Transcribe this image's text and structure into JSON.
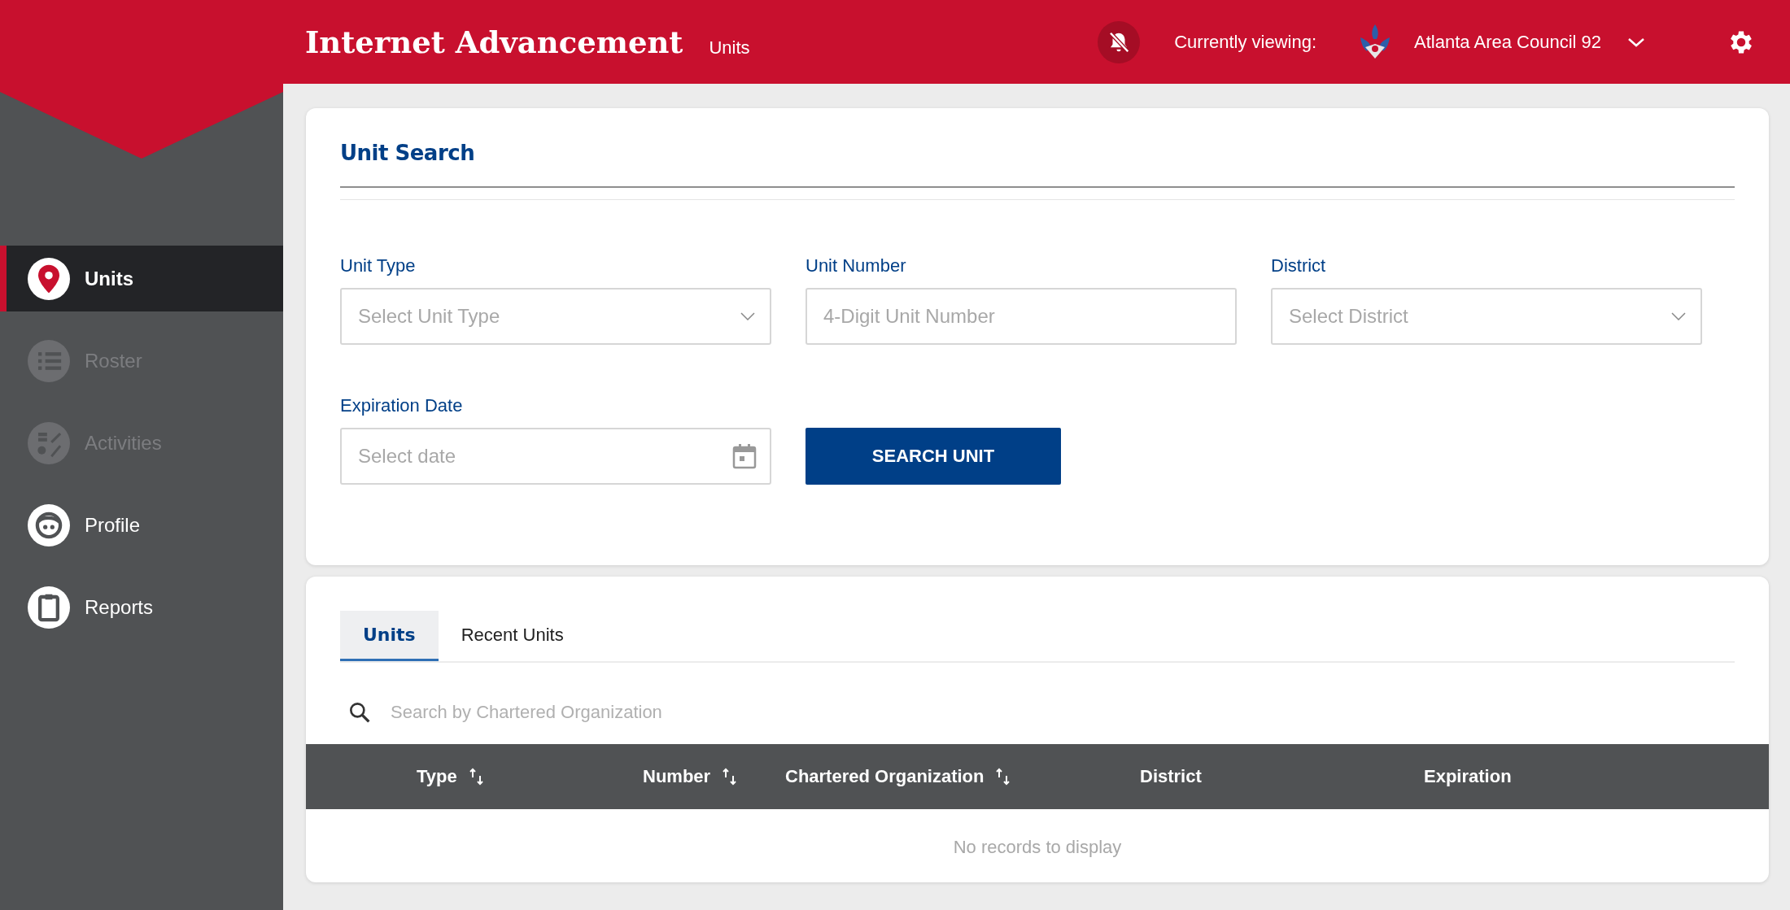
{
  "header": {
    "title": "Internet Advancement",
    "subtitle": "Units",
    "notifications_muted": true,
    "viewing_label": "Currently viewing:",
    "council": "Atlanta Area Council 92"
  },
  "sidebar": {
    "items": [
      {
        "label": "Units",
        "selected": true,
        "disabled": false
      },
      {
        "label": "Roster",
        "selected": false,
        "disabled": true
      },
      {
        "label": "Activities",
        "selected": false,
        "disabled": true
      },
      {
        "label": "Profile",
        "selected": false,
        "disabled": false
      },
      {
        "label": "Reports",
        "selected": false,
        "disabled": false
      }
    ]
  },
  "unit_search": {
    "title": "Unit Search",
    "fields": [
      {
        "label": "Unit Type",
        "kind": "select",
        "placeholder": "Select Unit Type"
      },
      {
        "label": "Unit Number",
        "kind": "text",
        "placeholder": "4-Digit Unit Number"
      },
      {
        "label": "District",
        "kind": "select",
        "placeholder": "Select District"
      },
      {
        "label": "Expiration Date",
        "kind": "date",
        "placeholder": "Select date"
      }
    ],
    "button": "SEARCH UNIT"
  },
  "results": {
    "tabs": [
      {
        "label": "Units",
        "selected": true
      },
      {
        "label": "Recent Units",
        "selected": false
      }
    ],
    "search": {
      "placeholder": "Search by Chartered Organization"
    },
    "table": {
      "columns": [
        {
          "label": "Type",
          "sortable": true
        },
        {
          "label": "Number",
          "sortable": true
        },
        {
          "label": "Chartered Organization",
          "sortable": true
        },
        {
          "label": "District",
          "sortable": false
        },
        {
          "label": "Expiration",
          "sortable": false
        }
      ],
      "empty_message": "No records to display"
    }
  }
}
